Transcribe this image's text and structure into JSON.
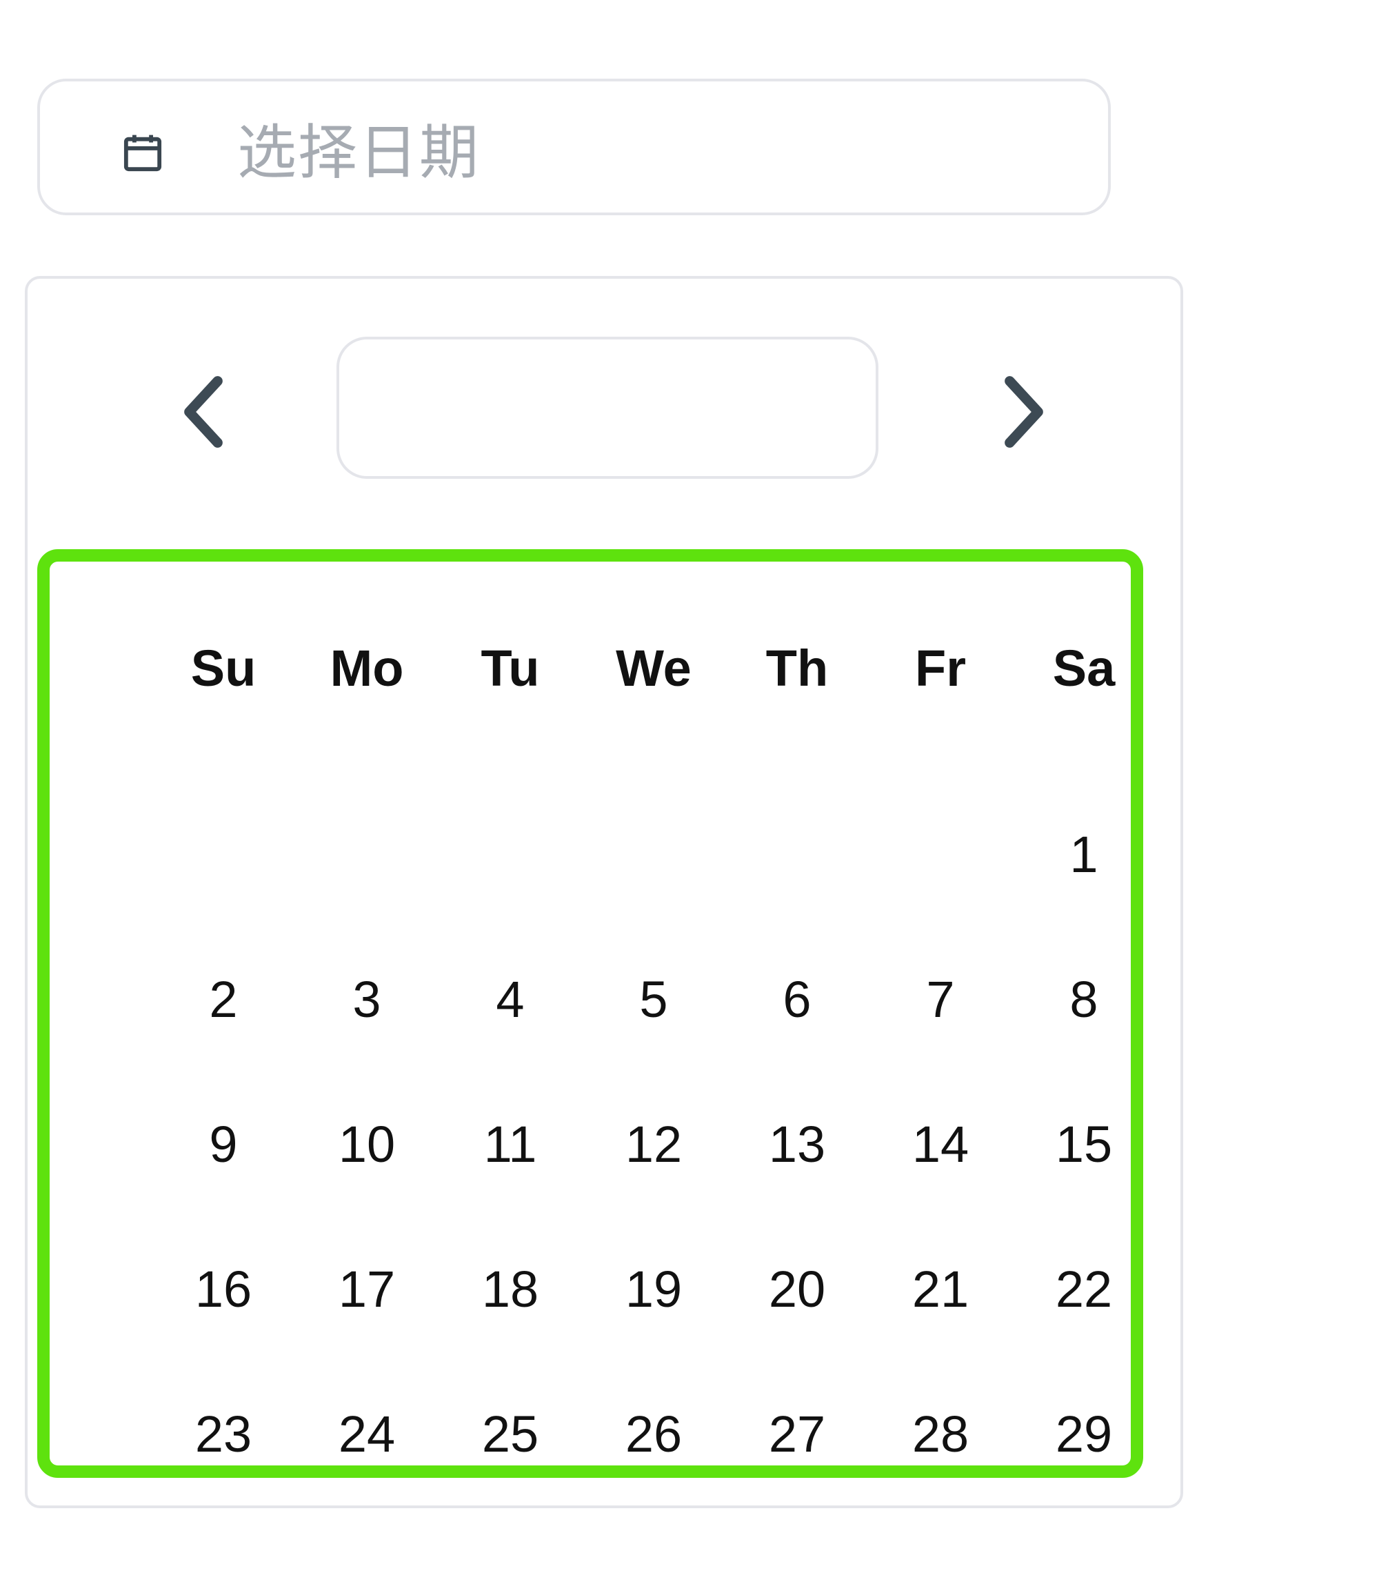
{
  "date_input": {
    "placeholder": "选择日期",
    "icon": "calendar-icon"
  },
  "calendar": {
    "prev_icon": "chevron-left-icon",
    "next_icon": "chevron-right-icon",
    "month_label": "",
    "weekdays": [
      "Su",
      "Mo",
      "Tu",
      "We",
      "Th",
      "Fr",
      "Sa"
    ],
    "weeks": [
      [
        "",
        "",
        "",
        "",
        "",
        "",
        "1"
      ],
      [
        "2",
        "3",
        "4",
        "5",
        "6",
        "7",
        "8"
      ],
      [
        "9",
        "10",
        "11",
        "12",
        "13",
        "14",
        "15"
      ],
      [
        "16",
        "17",
        "18",
        "19",
        "20",
        "21",
        "22"
      ],
      [
        "23",
        "24",
        "25",
        "26",
        "27",
        "28",
        "29"
      ]
    ],
    "highlight_color": "#5ee20e"
  }
}
